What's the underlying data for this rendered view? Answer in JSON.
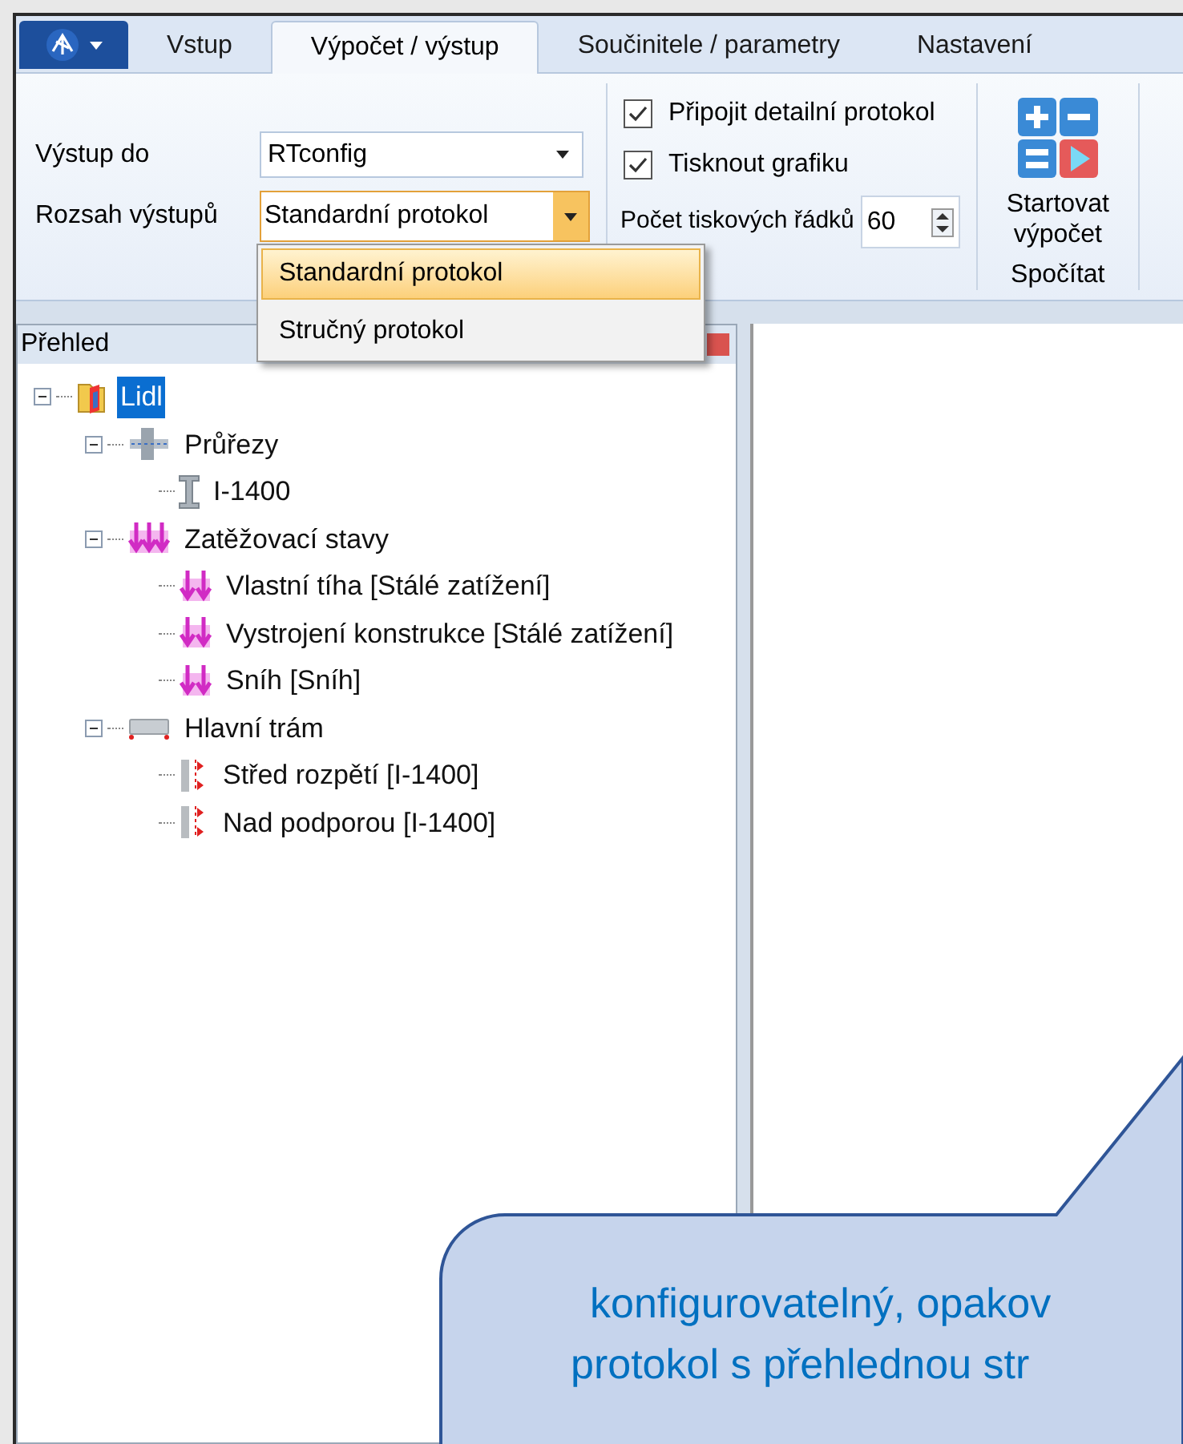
{
  "tabs": [
    {
      "label": "Vstup",
      "selected": false
    },
    {
      "label": "Výpočet / výstup",
      "selected": true
    },
    {
      "label": "Součinitele / parametry",
      "selected": false
    },
    {
      "label": "Nastavení",
      "selected": false
    }
  ],
  "ribbon": {
    "output_to": {
      "label": "Výstup do",
      "value": "RTconfig"
    },
    "output_range": {
      "label": "Rozsah výstupů",
      "value": "Standardní protokol",
      "expanded": true,
      "options": [
        {
          "label": "Standardní protokol",
          "selected": true
        },
        {
          "label": "Stručný protokol",
          "selected": false
        }
      ]
    },
    "checkboxes": [
      {
        "label": "Připojit detailní protokol",
        "checked": true
      },
      {
        "label": "Tisknout grafiku",
        "checked": true
      }
    ],
    "print_lines": {
      "label": "Počet tiskových řádků",
      "value": "60"
    },
    "start_button": {
      "label": "Startovat výpočet"
    },
    "group_label": "Spočítat"
  },
  "overview": {
    "title": "Přehled",
    "tree": [
      {
        "label": "Lidl",
        "kind": "project",
        "selected": true,
        "expanded": true,
        "children": [
          {
            "label": "Průřezy",
            "kind": "sections",
            "selected": false,
            "expanded": true,
            "children": [
              {
                "label": "I-1400",
                "kind": "section",
                "selected": false
              }
            ]
          },
          {
            "label": "Zatěžovací stavy",
            "kind": "loads",
            "selected": false,
            "expanded": true,
            "children": [
              {
                "label": "Vlastní tíha [Stálé zatížení]",
                "kind": "load",
                "selected": false
              },
              {
                "label": "Vystrojení konstrukce [Stálé zatížení]",
                "kind": "load",
                "selected": false
              },
              {
                "label": "Sníh [Sníh]",
                "kind": "load",
                "selected": false
              }
            ]
          },
          {
            "label": "Hlavní trám",
            "kind": "beam",
            "selected": false,
            "expanded": true,
            "children": [
              {
                "label": "Střed rozpětí [I-1400]",
                "kind": "point",
                "selected": false
              },
              {
                "label": "Nad podporou [I-1400]",
                "kind": "point",
                "selected": false
              }
            ]
          }
        ]
      }
    ]
  },
  "callout": {
    "lines": [
      "konfigurovatelný, opakov",
      "protokol s přehlednou str"
    ]
  }
}
